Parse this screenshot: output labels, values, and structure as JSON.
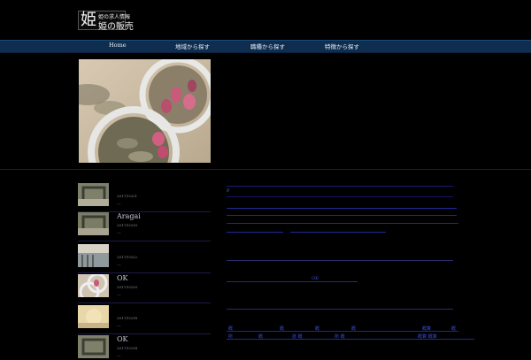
{
  "logo": {
    "big": "姫",
    "small": "姫の求人情報",
    "name": "姫の販売"
  },
  "nav": [
    {
      "label": "Home"
    },
    {
      "label": "地域から探す"
    },
    {
      "label": "職種から探す"
    },
    {
      "label": "特徴から探す"
    }
  ],
  "posts": [
    {
      "title": "",
      "date": "2017/10/21",
      "more": "..."
    },
    {
      "title": "Aragai",
      "date": "2017/10/10",
      "more": "..."
    },
    {
      "title": "",
      "date": "2017/10/22",
      "more": "..."
    },
    {
      "title": "OK",
      "date": "2017/10/20",
      "more": "..."
    },
    {
      "title": "",
      "date": "2017/10/18",
      "more": "..."
    },
    {
      "title": "OK",
      "date": "2017/10/14",
      "more": "..."
    }
  ],
  "content": {
    "marker": "P",
    "link1": "OK",
    "row1": [
      "概",
      "概",
      "概",
      "概",
      "概算",
      "概"
    ],
    "row2": [
      "所",
      "概",
      "技 概",
      "所 概",
      "概算 概算"
    ]
  },
  "colors": {
    "nav": "#0f2e4f",
    "accent": "#3c4fd8"
  }
}
